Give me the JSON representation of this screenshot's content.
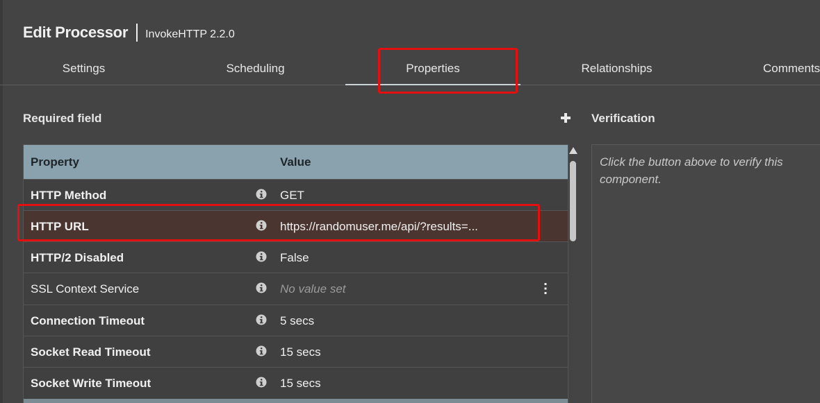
{
  "header": {
    "title": "Edit Processor",
    "subtitle": "InvokeHTTP 2.2.0"
  },
  "tabs": [
    {
      "label": "Settings"
    },
    {
      "label": "Scheduling"
    },
    {
      "label": "Properties",
      "active": true
    },
    {
      "label": "Relationships"
    },
    {
      "label": "Comments"
    }
  ],
  "properties_panel": {
    "required_label": "Required field",
    "add_icon": "plus-icon",
    "columns": {
      "property": "Property",
      "value": "Value"
    },
    "rows": [
      {
        "name": "HTTP Method",
        "required": true,
        "value": "GET",
        "value_set": true
      },
      {
        "name": "HTTP URL",
        "required": true,
        "value": "https://randomuser.me/api/?results=...",
        "value_set": true,
        "selected": true
      },
      {
        "name": "HTTP/2 Disabled",
        "required": true,
        "value": "False",
        "value_set": true
      },
      {
        "name": "SSL Context Service",
        "required": false,
        "value": "No value set",
        "value_set": false
      },
      {
        "name": "Connection Timeout",
        "required": true,
        "value": "5 secs",
        "value_set": true
      },
      {
        "name": "Socket Read Timeout",
        "required": true,
        "value": "15 secs",
        "value_set": true
      },
      {
        "name": "Socket Write Timeout",
        "required": true,
        "value": "15 secs",
        "value_set": true
      }
    ]
  },
  "verification": {
    "label": "Verification",
    "message": "Click the button above to verify this component."
  },
  "colors": {
    "background": "#444444",
    "table_header": "#8aa2ae",
    "selected_row": "#4a3530",
    "highlight": "#e41010"
  }
}
